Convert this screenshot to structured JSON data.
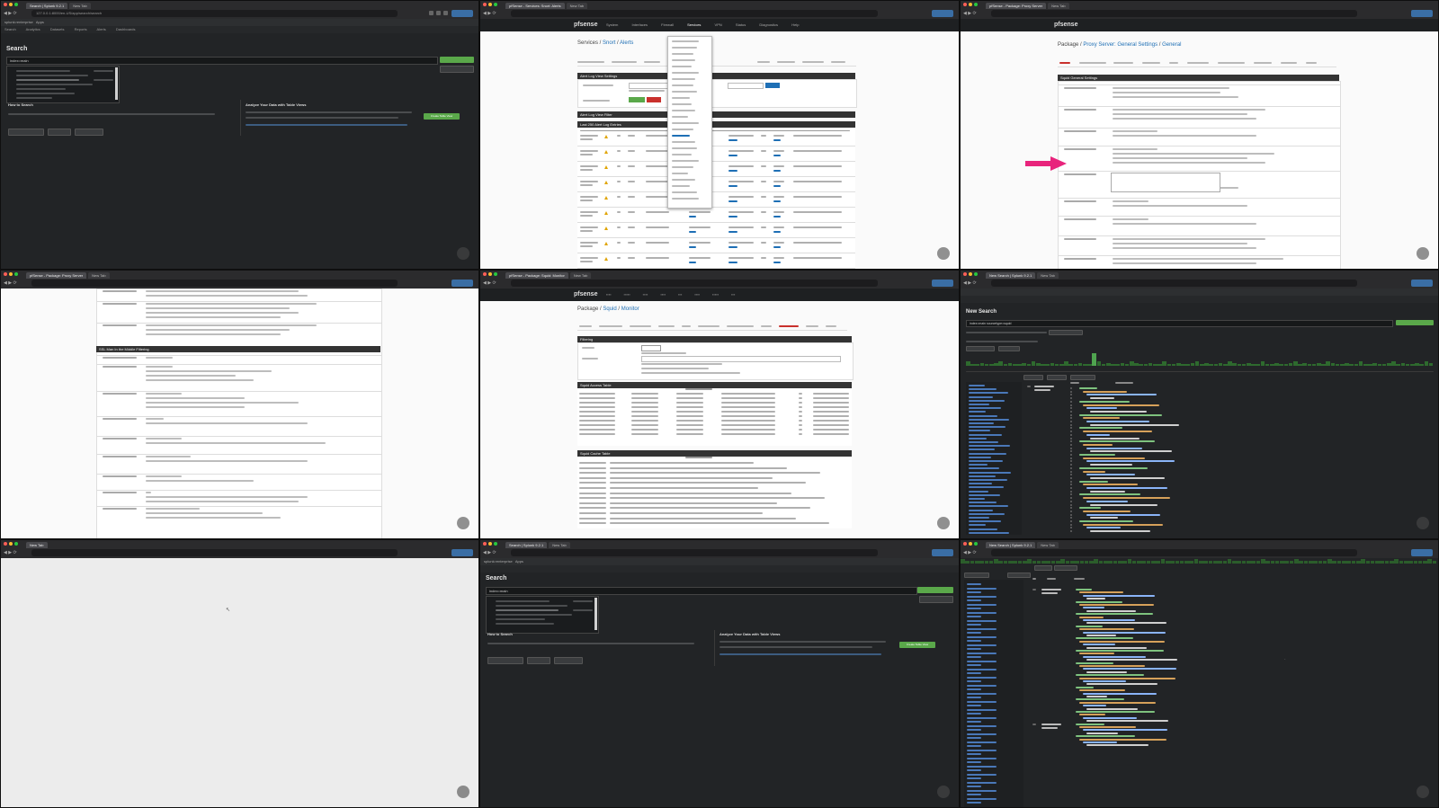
{
  "panels": [
    {
      "id": "p1",
      "tabs": [
        "Search | Splunk 9.2.1",
        "New Tab"
      ],
      "url": "127.0.0.1:8000/en-US/app/search/search",
      "app_label": "splunk>enterprise",
      "app_menu": "Apps",
      "nav": [
        "Search",
        "Analytics",
        "Datasets",
        "Reports",
        "Alerts",
        "Dashboards"
      ],
      "page_title": "Search",
      "query": "index=main",
      "section_left": "How to Search",
      "section_right": "Analyze Your Data with Table Views",
      "action_button": "Create Table View"
    },
    {
      "id": "p2",
      "tabs": [
        "pfSense - Services: Snort: Alerts",
        "New Tab"
      ],
      "logo": "sense",
      "menu": [
        "System",
        "Interfaces",
        "Firewall",
        "Services",
        "VPN",
        "Status",
        "Diagnostics",
        "Help"
      ],
      "crumb_root": "Services",
      "crumb_mid": "Snort",
      "crumb_leaf": "Alerts",
      "section_alert": "Alert Log View Settings",
      "section_filter": "Alert Log View Filter",
      "section_entries": "Last 250 Alert Log Entries"
    },
    {
      "id": "p3",
      "tabs": [
        "pfSense - Package: Proxy Server",
        "New Tab"
      ],
      "logo": "sense",
      "crumb_root": "Package",
      "crumb_mid": "Proxy Server: General Settings",
      "crumb_leaf": "General",
      "section": "Squid General Settings"
    },
    {
      "id": "p4",
      "tabs": [
        "pfSense - Package: Proxy Server",
        "New Tab"
      ],
      "section": "SSL Man In the Middle Filtering"
    },
    {
      "id": "p5",
      "tabs": [
        "pfSense - Package: Squid: Monitor",
        "New Tab"
      ],
      "logo": "sense",
      "crumb_root": "Package",
      "crumb_mid": "Squid",
      "crumb_leaf": "Monitor",
      "section_filter": "Filtering",
      "section_access": "Squid Access Table",
      "section_cache": "Squid Cache Table"
    },
    {
      "id": "p6",
      "tabs": [
        "New Search | Splunk 9.2.1",
        "New Tab"
      ],
      "page_title": "New Search",
      "query": "index=main sourcetype=squid"
    },
    {
      "id": "p7",
      "tabs": [
        "New Tab"
      ]
    },
    {
      "id": "p8",
      "tabs": [
        "Search | Splunk 9.2.1",
        "New Tab"
      ],
      "app_label": "splunk>enterprise",
      "app_menu": "Apps",
      "page_title": "Search",
      "query": "index=main",
      "section_left": "How to Search",
      "section_right": "Analyze Your Data with Table Views",
      "action_button": "Create Table View"
    },
    {
      "id": "p9",
      "tabs": [
        "New Search | Splunk 9.2.1",
        "New Tab"
      ]
    }
  ],
  "colors": {
    "accent_green": "#5aa84a",
    "pink_arrow": "#e8247c",
    "warning": "#e0a400",
    "link_blue": "#1e6fb5"
  }
}
